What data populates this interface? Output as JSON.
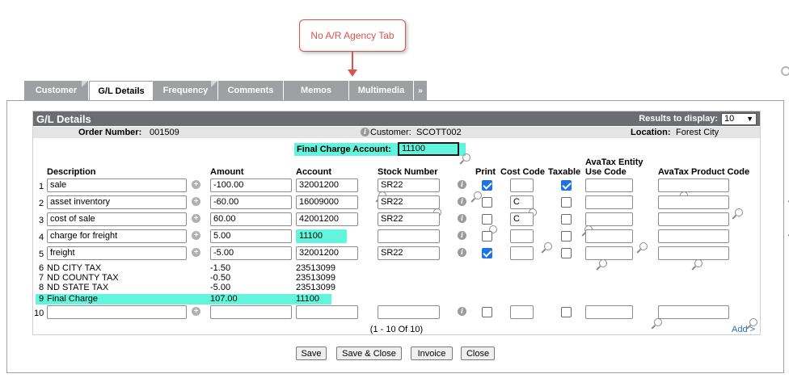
{
  "annotation": {
    "callout_text": "No A/R Agency Tab"
  },
  "tabs": [
    {
      "label": "Customer",
      "active": false
    },
    {
      "label": "G/L Details",
      "active": true
    },
    {
      "label": "Frequency",
      "active": false
    },
    {
      "label": "Comments",
      "active": false
    },
    {
      "label": "Memos",
      "active": false
    },
    {
      "label": "Multimedia",
      "active": false
    }
  ],
  "tab_more": "»",
  "grid": {
    "title": "G/L Details",
    "results_label": "Results to display:",
    "results_value": "10"
  },
  "info": {
    "order_label": "Order Number:",
    "order_value": "001509",
    "customer_label": "Customer:",
    "customer_value": "SCOTT002",
    "location_label": "Location:",
    "location_value": "Forest City"
  },
  "final_charge_account": {
    "label": "Final Charge Account:",
    "value": "11100"
  },
  "columns": {
    "description": "Description",
    "amount": "Amount",
    "account": "Account",
    "stock_number": "Stock Number",
    "print": "Print",
    "cost_code": "Cost Code",
    "taxable": "Taxable",
    "avatax_entity_1": "AvaTax Entity",
    "avatax_entity_2": "Use Code",
    "avatax_product": "AvaTax Product Code"
  },
  "rows": [
    {
      "num": "1",
      "description": "sale",
      "amount": "-100.00",
      "account": "32001200",
      "stock": "SR22",
      "print": true,
      "cost_code": "",
      "taxable": true
    },
    {
      "num": "2",
      "description": "asset inventory",
      "amount": "-60.00",
      "account": "16009000",
      "stock": "SR22",
      "print": false,
      "cost_code": "C",
      "taxable": false
    },
    {
      "num": "3",
      "description": "cost of sale",
      "amount": "60.00",
      "account": "42001200",
      "stock": "SR22",
      "print": false,
      "cost_code": "C",
      "taxable": false
    },
    {
      "num": "4",
      "description": "charge for freight",
      "amount": "5.00",
      "account": "11100",
      "stock": "",
      "print": false,
      "cost_code": "",
      "taxable": false
    },
    {
      "num": "5",
      "description": "freight",
      "amount": "-5.00",
      "account": "32001200",
      "stock": "SR22",
      "print": true,
      "cost_code": "",
      "taxable": false
    }
  ],
  "static_rows": [
    {
      "num": "6",
      "description": "ND CITY TAX",
      "amount": "-1.50",
      "account": "23513099"
    },
    {
      "num": "7",
      "description": "ND COUNTY TAX",
      "amount": "-0.50",
      "account": "23513099"
    },
    {
      "num": "8",
      "description": "ND STATE TAX",
      "amount": "-5.00",
      "account": "23513099"
    },
    {
      "num": "9",
      "description": "Final Charge",
      "amount": "107.00",
      "account": "11100"
    }
  ],
  "new_row": {
    "num": "10"
  },
  "pager": "(1  -  10  Of  10)",
  "add_link": "Add >",
  "buttons": {
    "save": "Save",
    "save_close": "Save & Close",
    "invoice": "Invoice",
    "close": "Close"
  }
}
